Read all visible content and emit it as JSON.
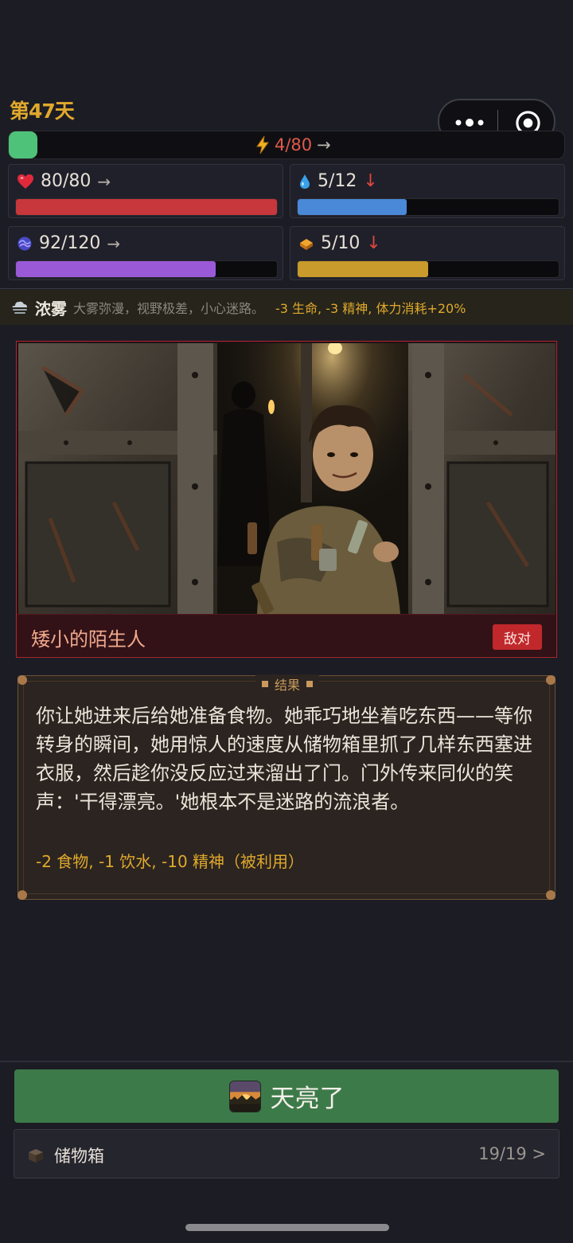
{
  "header": {
    "day": "第47天"
  },
  "energy": {
    "text": "4/80",
    "trend": "→",
    "level": 0.05,
    "color": "#4fc27a"
  },
  "stats": [
    {
      "icon": "heart-icon",
      "text": "80/80",
      "trend": "→",
      "level": 1.0,
      "color": "#c8373c"
    },
    {
      "icon": "water-drop-icon",
      "text": "5/12",
      "trend": "↓",
      "level": 0.4167,
      "color": "#4a88d8"
    },
    {
      "icon": "mind-orb-icon",
      "text": "92/120",
      "trend": "→",
      "level": 0.7667,
      "color": "#9a5ad8"
    },
    {
      "icon": "food-icon",
      "text": "5/10",
      "trend": "↓",
      "level": 0.5,
      "color": "#c99a2c"
    }
  ],
  "weather": {
    "icon": "fog-icon",
    "name": "浓雾",
    "description": "大雾弥漫，视野极差，小心迷路。",
    "effects": "-3 生命, -3 精神, 体力消耗+20%"
  },
  "event": {
    "title": "矮小的陌生人",
    "badge": "敌对"
  },
  "result": {
    "label": "结果",
    "text": "你让她进来后给她准备食物。她乖巧地坐着吃东西——等你转身的瞬间，她用惊人的速度从储物箱里抓了几样东西塞进衣服，然后趁你没反应过来溜出了门。门外传来同伙的笑声：'干得漂亮。'她根本不是迷路的流浪者。",
    "effects": "-2 食物, -1 饮水, -10 精神（被利用）"
  },
  "actions": {
    "dawn_label": "天亮了",
    "storage_label": "储物箱",
    "storage_count": "19/19 >"
  }
}
